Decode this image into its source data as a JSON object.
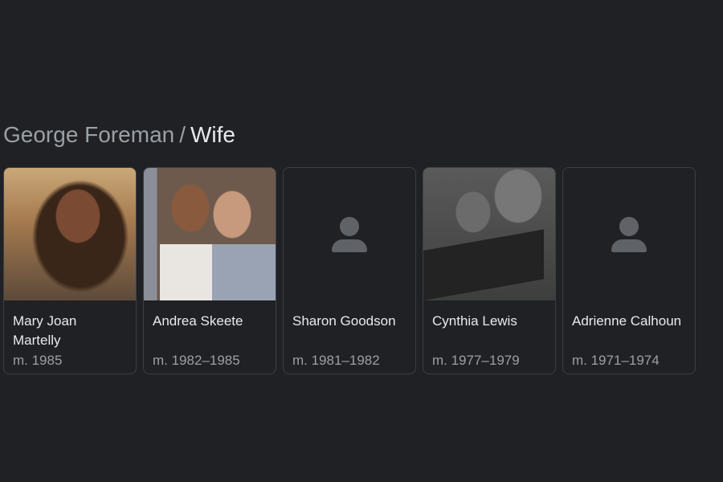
{
  "breadcrumb": {
    "parent": "George Foreman",
    "separator": "/",
    "current": "Wife"
  },
  "cards": [
    {
      "name": "Mary Joan Martelly",
      "detail": "m. 1985",
      "has_photo": true
    },
    {
      "name": "Andrea Skeete",
      "detail": "m. 1982–1985",
      "has_photo": true
    },
    {
      "name": "Sharon Goodson",
      "detail": "m. 1981–1982",
      "has_photo": false,
      "icon": "person-icon"
    },
    {
      "name": "Cynthia Lewis",
      "detail": "m. 1977–1979",
      "has_photo": true
    },
    {
      "name": "Adrienne Calhoun",
      "detail": "m. 1971–1974",
      "has_photo": false,
      "icon": "person-icon"
    }
  ],
  "colors": {
    "background": "#202124",
    "primary_text": "#e8eaed",
    "secondary_text": "#9aa0a6",
    "card_border": "#3c4043",
    "placeholder_icon": "#5f6368"
  }
}
